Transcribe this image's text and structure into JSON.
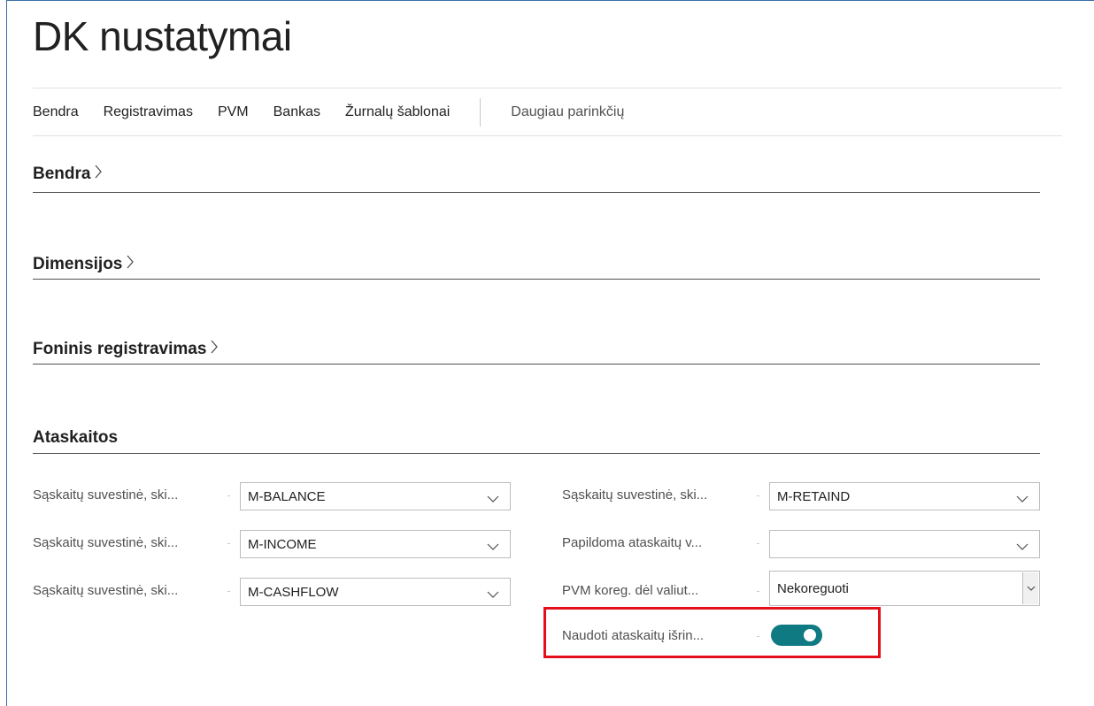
{
  "page": {
    "title": "DK nustatymai"
  },
  "nav": {
    "items": [
      "Bendra",
      "Registravimas",
      "PVM",
      "Bankas",
      "Žurnalų šablonai"
    ],
    "more": "Daugiau parinkčių"
  },
  "sections": {
    "bendra": "Bendra",
    "dimensijos": "Dimensijos",
    "foninis": "Foninis registravimas",
    "ataskaitos": "Ataskaitos"
  },
  "fields": {
    "left": [
      {
        "label": "Sąskaitų suvestinė, ski...",
        "value": "M-BALANCE"
      },
      {
        "label": "Sąskaitų suvestinė, ski...",
        "value": "M-INCOME"
      },
      {
        "label": "Sąskaitų suvestinė, ski...",
        "value": "M-CASHFLOW"
      }
    ],
    "right": [
      {
        "label": "Sąskaitų suvestinė, ski...",
        "value": "M-RETAIND"
      },
      {
        "label": "Papildoma ataskaitų v...",
        "value": ""
      },
      {
        "label": "PVM koreg. dėl valiut...",
        "value": "Nekoreguoti"
      }
    ],
    "toggle": {
      "label": "Naudoti ataskaitų išrin...",
      "on": true
    }
  },
  "colors": {
    "accent": "#0f7a82",
    "highlight": "#e3101c",
    "frame": "#3a6ea5"
  },
  "icons": {
    "section_expand": "chevron-right-icon",
    "dropdown": "chevron-down-icon"
  }
}
